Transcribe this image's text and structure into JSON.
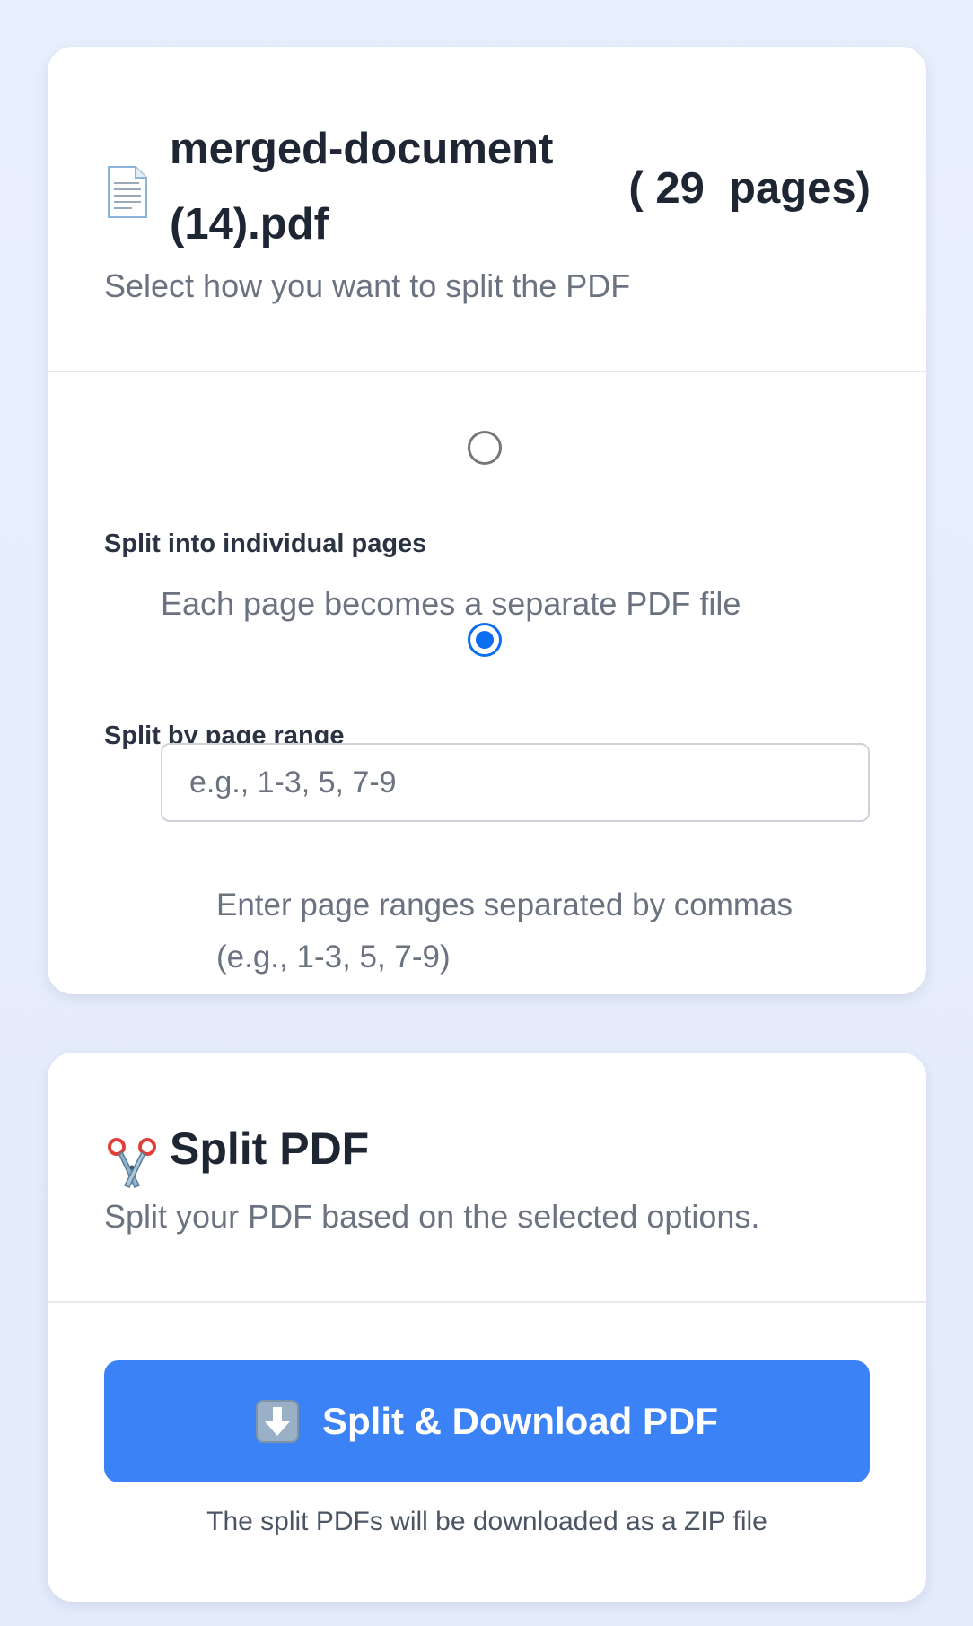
{
  "file": {
    "name": "merged-document (14).pdf",
    "page_count_text": "( 29  pages)",
    "icon": "page-document-icon"
  },
  "options_card": {
    "subtitle": "Select how you want to split the PDF",
    "options": [
      {
        "label": "Split into individual pages",
        "description": "Each page becomes a separate PDF file",
        "selected": false
      },
      {
        "label": "Split by page range",
        "selected": true
      }
    ],
    "range_input": {
      "value": "",
      "placeholder": "e.g., 1-3, 5, 7-9"
    },
    "range_hint": "Enter page ranges separated by commas (e.g., 1-3, 5, 7-9)"
  },
  "split_card": {
    "icon": "scissors-icon",
    "title": "Split PDF",
    "subtitle": "Split your PDF based on the selected options.",
    "button_label": "Split & Download PDF",
    "button_icon": "down-arrow-icon",
    "note": "The split PDFs will be downloaded as a ZIP file"
  },
  "colors": {
    "background": "#e8effc",
    "accent_button": "#3b82f6",
    "radio_selected": "#0b6df0",
    "heading_text": "#1e2533",
    "muted_text": "#6b7280"
  }
}
